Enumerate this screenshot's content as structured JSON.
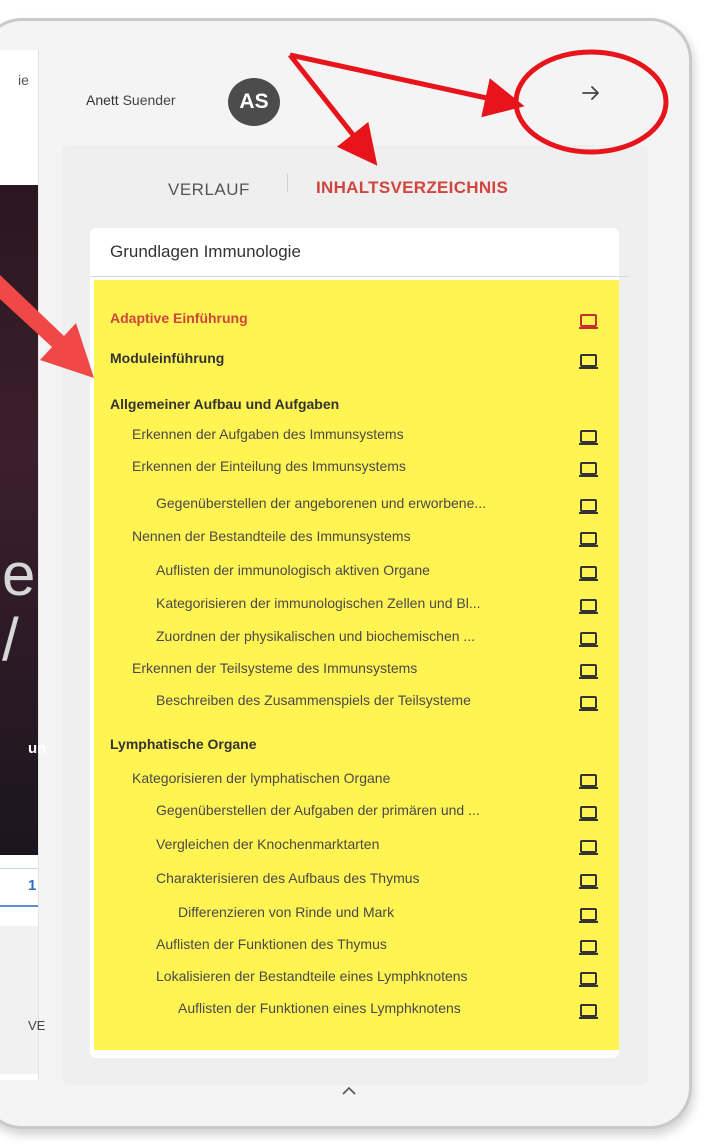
{
  "background_left": {
    "top_fragment": "ie",
    "big_fragment_1": "e",
    "big_fragment_2": "/",
    "bold_fragment": "un",
    "tab_fragment": "1",
    "gray_fragment": "VE"
  },
  "header": {
    "user_first": "Anett",
    "user_last": "Suender",
    "avatar_initials": "AS",
    "close_icon": "arrow-right-icon"
  },
  "tabs": [
    {
      "label": "VERLAUF",
      "active": false
    },
    {
      "label": "INHALTSVERZEICHNIS",
      "active": true
    }
  ],
  "course": {
    "title": "Grundlagen Immunologie"
  },
  "toc": [
    {
      "label": "Adaptive Einführung",
      "level": 0,
      "highlight": true,
      "icon": "device-icon"
    },
    {
      "label": "Moduleinführung",
      "level": 0,
      "icon": "device-icon"
    },
    {
      "label": "Allgemeiner Aufbau und Aufgaben",
      "level": 0
    },
    {
      "label": "Erkennen der Aufgaben des Immunsystems",
      "level": 1,
      "icon": "device-icon"
    },
    {
      "label": "Erkennen der Einteilung des Immunsystems",
      "level": 1,
      "icon": "device-icon"
    },
    {
      "label": "Gegenüberstellen der angeborenen und erworbene...",
      "level": 2,
      "icon": "device-icon"
    },
    {
      "label": "Nennen der Bestandteile des Immunsystems",
      "level": 1,
      "icon": "device-icon"
    },
    {
      "label": "Auflisten der immunologisch aktiven Organe",
      "level": 2,
      "icon": "device-icon"
    },
    {
      "label": "Kategorisieren der immunologischen Zellen und Bl...",
      "level": 2,
      "icon": "device-icon"
    },
    {
      "label": "Zuordnen der physikalischen und biochemischen ...",
      "level": 2,
      "icon": "device-icon"
    },
    {
      "label": "Erkennen der Teilsysteme des Immunsystems",
      "level": 1,
      "icon": "device-icon"
    },
    {
      "label": "Beschreiben des Zusammenspiels der Teilsysteme",
      "level": 2,
      "icon": "device-icon"
    },
    {
      "label": "Lymphatische Organe",
      "level": 0
    },
    {
      "label": "Kategorisieren der lymphatischen Organe",
      "level": 1,
      "icon": "device-icon"
    },
    {
      "label": "Gegenüberstellen der Aufgaben der primären und ...",
      "level": 2,
      "icon": "device-icon"
    },
    {
      "label": "Vergleichen der Knochenmarktarten",
      "level": 2,
      "icon": "device-icon"
    },
    {
      "label": "Charakterisieren des Aufbaus des Thymus",
      "level": 2,
      "icon": "device-icon"
    },
    {
      "label": "Differenzieren von Rinde und Mark",
      "level": 3,
      "icon": "device-icon"
    },
    {
      "label": "Auflisten der Funktionen des Thymus",
      "level": 2,
      "icon": "device-icon"
    },
    {
      "label": "Lokalisieren der Bestandteile eines Lymphknotens",
      "level": 2,
      "icon": "device-icon"
    },
    {
      "label": "Auflisten der Funktionen eines Lymphknotens",
      "level": 3,
      "icon": "device-icon"
    }
  ],
  "footer": {
    "collapse_icon": "chevron-up-icon"
  },
  "colors": {
    "accent_red": "#d0453e",
    "highlight_yellow": "#fff451",
    "annotation_red": "#e8141c"
  }
}
